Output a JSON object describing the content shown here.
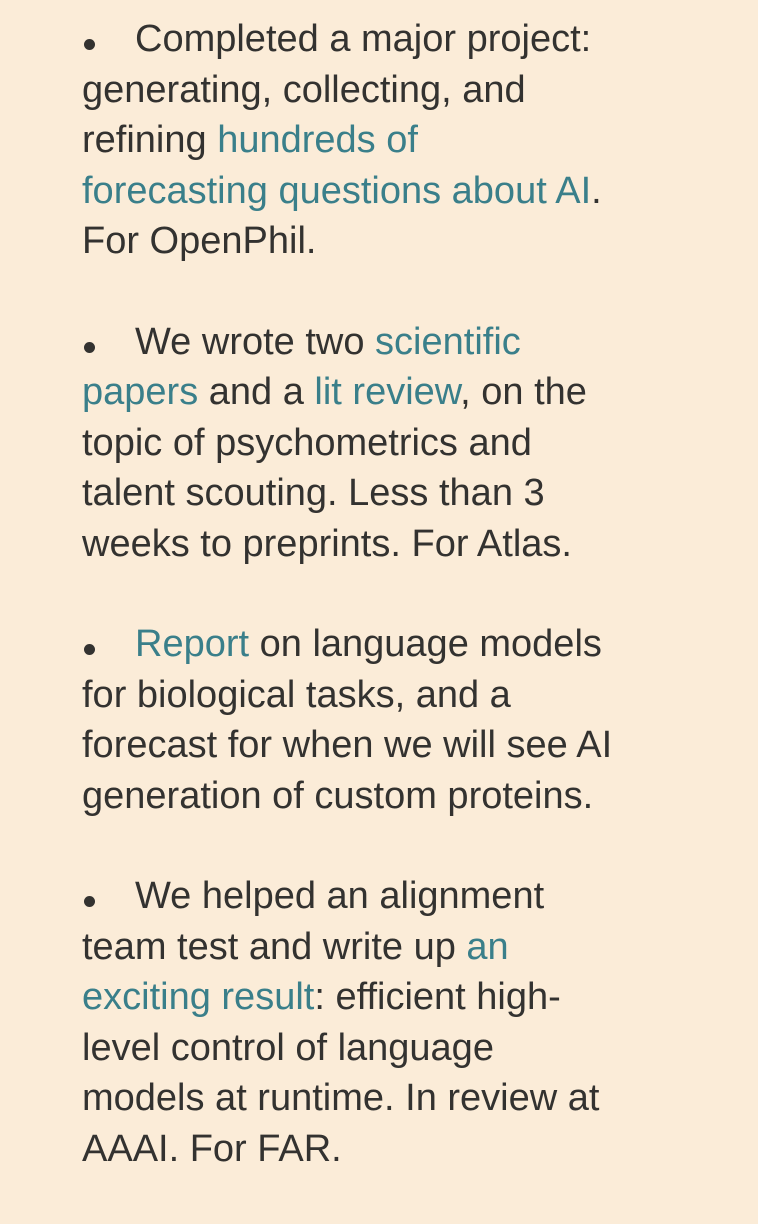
{
  "colors": {
    "background": "#fbecd8",
    "text": "#333230",
    "link": "#3a7f8a"
  },
  "items": [
    {
      "lines": [
        [
          {
            "text": "Completed a major project:"
          }
        ],
        [
          {
            "text": "generating, collecting, and"
          }
        ],
        [
          {
            "text": "refining "
          },
          {
            "text": "hundreds of",
            "link": true
          }
        ],
        [
          {
            "text": "forecasting questions about AI",
            "link": true
          },
          {
            "text": "."
          }
        ],
        [
          {
            "text": "For OpenPhil."
          }
        ]
      ]
    },
    {
      "lines": [
        [
          {
            "text": "We wrote two "
          },
          {
            "text": "scientific",
            "link": true
          }
        ],
        [
          {
            "text": "papers",
            "link": true
          },
          {
            "text": " and a "
          },
          {
            "text": "lit review",
            "link": true
          },
          {
            "text": ", on the"
          }
        ],
        [
          {
            "text": "topic of psychometrics and"
          }
        ],
        [
          {
            "text": "talent scouting. Less than 3"
          }
        ],
        [
          {
            "text": "weeks to preprints. For Atlas."
          }
        ]
      ]
    },
    {
      "lines": [
        [
          {
            "text": "Report",
            "link": true
          },
          {
            "text": " on language models"
          }
        ],
        [
          {
            "text": "for biological tasks, and a"
          }
        ],
        [
          {
            "text": "forecast for when we will see AI"
          }
        ],
        [
          {
            "text": "generation of custom proteins."
          }
        ]
      ]
    },
    {
      "lines": [
        [
          {
            "text": "We helped an alignment"
          }
        ],
        [
          {
            "text": "team test and write up "
          },
          {
            "text": "an",
            "link": true
          }
        ],
        [
          {
            "text": "exciting result",
            "link": true
          },
          {
            "text": ": efficient high-"
          }
        ],
        [
          {
            "text": "level control of language"
          }
        ],
        [
          {
            "text": "models at runtime. In review at"
          }
        ],
        [
          {
            "text": "AAAI. For FAR."
          }
        ]
      ]
    }
  ]
}
